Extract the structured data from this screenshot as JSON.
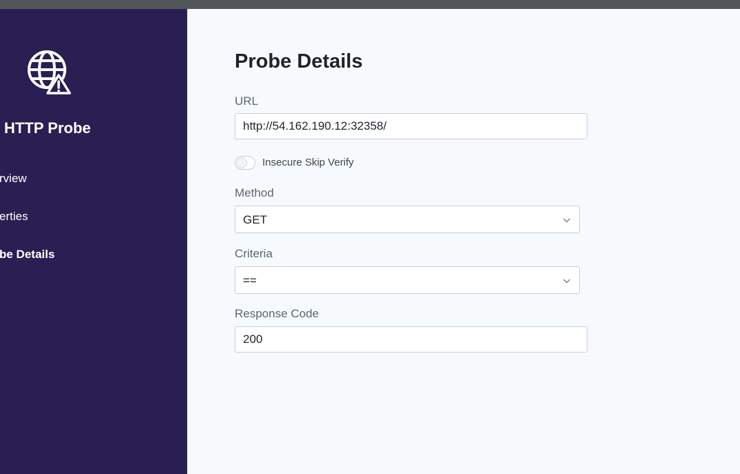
{
  "sidebar": {
    "brand_icon": "globe-warning-icon",
    "title": "HTTP Probe",
    "nav": [
      {
        "label": "rview",
        "active": false
      },
      {
        "label": "erties",
        "active": false
      },
      {
        "label": "be Details",
        "active": true
      }
    ],
    "background": "#291f53"
  },
  "main": {
    "title": "Probe Details",
    "url": {
      "label": "URL",
      "value": "http://54.162.190.12:32358/"
    },
    "insecure_skip_verify": {
      "label": "Insecure Skip Verify",
      "enabled": false
    },
    "method": {
      "label": "Method",
      "value": "GET"
    },
    "criteria": {
      "label": "Criteria",
      "value": "=="
    },
    "response_code": {
      "label": "Response Code",
      "value": "200"
    },
    "background": "#f6fafd"
  }
}
